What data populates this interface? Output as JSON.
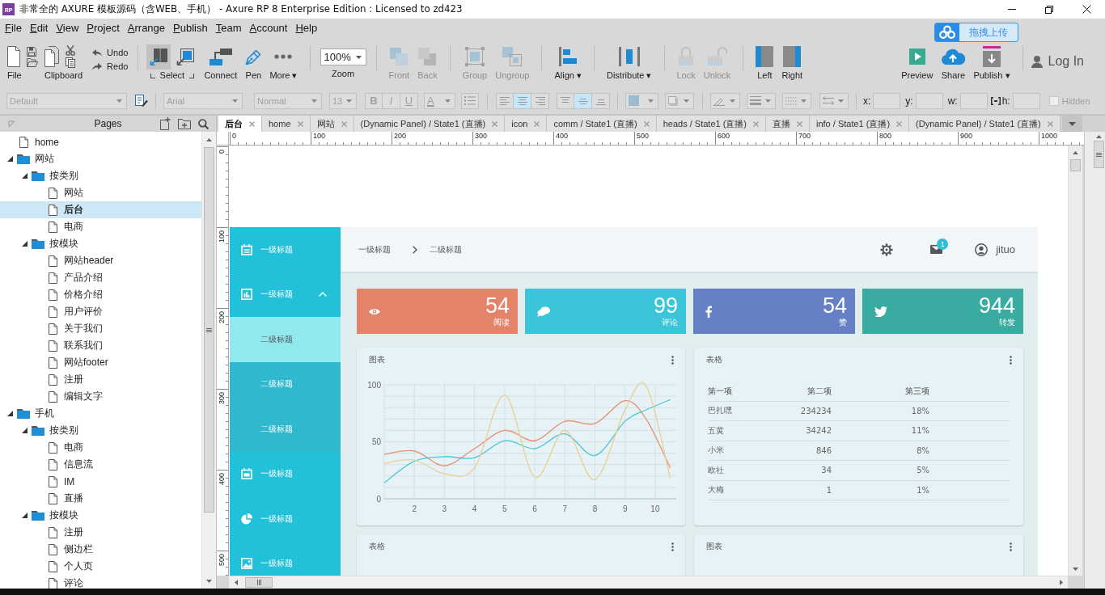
{
  "window": {
    "icon_label": "RP",
    "title": "非常全的 AXURE 模板源码（含WEB、手机） - Axure RP 8 Enterprise Edition : Licensed to zd423"
  },
  "menu": [
    {
      "label": "File"
    },
    {
      "label": "Edit"
    },
    {
      "label": "View"
    },
    {
      "label": "Project"
    },
    {
      "label": "Arrange"
    },
    {
      "label": "Publish"
    },
    {
      "label": "Team"
    },
    {
      "label": "Account"
    },
    {
      "label": "Help"
    }
  ],
  "upload_widget": {
    "label": "拖拽上传"
  },
  "toolbar": {
    "main": [
      [
        {
          "kind": "stack",
          "label": "File"
        },
        {
          "kind": "stack",
          "label": "Clipboard"
        },
        {
          "kind": "history",
          "items": [
            {
              "label": "Undo"
            },
            {
              "label": "Redo"
            }
          ]
        }
      ],
      [
        {
          "kind": "select",
          "label": "Select",
          "modes": [
            {
              "selected": true
            },
            {
              "selected": false
            }
          ]
        },
        {
          "kind": "tool",
          "label": "Connect",
          "disabled": false
        },
        {
          "kind": "tool",
          "label": "Pen",
          "disabled": false
        },
        {
          "kind": "tool",
          "label": "More ▾",
          "disabled": false
        }
      ],
      [
        {
          "kind": "zoom",
          "label": "Zoom",
          "value": "100%"
        }
      ],
      [
        {
          "kind": "tool",
          "label": "Front",
          "disabled": true
        },
        {
          "kind": "tool",
          "label": "Back",
          "disabled": true
        }
      ],
      [
        {
          "kind": "tool",
          "label": "Group",
          "disabled": true
        },
        {
          "kind": "tool",
          "label": "Ungroup",
          "disabled": true
        }
      ],
      [
        {
          "kind": "tool",
          "label": "Align ▾",
          "disabled": false
        }
      ],
      [
        {
          "kind": "tool",
          "label": "Distribute ▾",
          "disabled": false
        }
      ],
      [
        {
          "kind": "tool",
          "label": "Lock",
          "disabled": true
        },
        {
          "kind": "tool",
          "label": "Unlock",
          "disabled": true
        }
      ],
      [
        {
          "kind": "tool",
          "label": "Left",
          "disabled": false
        },
        {
          "kind": "tool",
          "label": "Right",
          "disabled": false
        }
      ]
    ],
    "end": [
      [
        {
          "kind": "tool",
          "label": "Preview",
          "disabled": false
        },
        {
          "kind": "tool",
          "label": "Share",
          "disabled": false
        },
        {
          "kind": "tool",
          "label": "Publish ▾",
          "disabled": false
        }
      ],
      [
        {
          "kind": "login",
          "label": "Log In"
        }
      ]
    ]
  },
  "format_bar": {
    "disabled": true,
    "style": "Default",
    "font": "Arial",
    "weight": "Normal",
    "size": "13",
    "text_buttons": [
      "B",
      "I",
      "U"
    ],
    "color_button": "A",
    "align": [
      {
        "selected": false
      },
      {
        "selected": true
      },
      {
        "selected": false
      }
    ],
    "valign": [
      {
        "selected": false
      },
      {
        "selected": true
      },
      {
        "selected": false
      }
    ],
    "fields": [
      {
        "label": "x:"
      },
      {
        "label": "y:"
      },
      {
        "label": "w:"
      },
      {
        "label": "h:"
      }
    ],
    "hidden": {
      "label": "Hidden",
      "checked": false
    }
  },
  "pages_panel": {
    "title": "Pages",
    "tree": [
      {
        "kind": "page",
        "label": "home",
        "selected": false
      },
      {
        "kind": "folder",
        "label": "网站",
        "expanded": true,
        "selected": false,
        "children": [
          {
            "kind": "folder",
            "label": "按类别",
            "expanded": true,
            "selected": false,
            "children": [
              {
                "kind": "page",
                "label": "网站",
                "selected": false
              },
              {
                "kind": "page",
                "label": "后台",
                "selected": true
              },
              {
                "kind": "page",
                "label": "电商",
                "selected": false
              }
            ]
          },
          {
            "kind": "folder",
            "label": "按模块",
            "expanded": true,
            "selected": false,
            "children": [
              {
                "kind": "page",
                "label": "网站header",
                "selected": false
              },
              {
                "kind": "page",
                "label": "产品介绍",
                "selected": false
              },
              {
                "kind": "page",
                "label": "价格介绍",
                "selected": false
              },
              {
                "kind": "page",
                "label": "用户评价",
                "selected": false
              },
              {
                "kind": "page",
                "label": "关于我们",
                "selected": false
              },
              {
                "kind": "page",
                "label": "联系我们",
                "selected": false
              },
              {
                "kind": "page",
                "label": "网站footer",
                "selected": false
              },
              {
                "kind": "page",
                "label": "注册",
                "selected": false
              },
              {
                "kind": "page",
                "label": "编辑文字",
                "selected": false
              }
            ]
          }
        ]
      },
      {
        "kind": "folder",
        "label": "手机",
        "expanded": true,
        "selected": false,
        "children": [
          {
            "kind": "folder",
            "label": "按类别",
            "expanded": true,
            "selected": false,
            "children": [
              {
                "kind": "page",
                "label": "电商",
                "selected": false
              },
              {
                "kind": "page",
                "label": "信息流",
                "selected": false
              },
              {
                "kind": "page",
                "label": "IM",
                "selected": false
              },
              {
                "kind": "page",
                "label": "直播",
                "selected": false
              }
            ]
          },
          {
            "kind": "folder",
            "label": "按模块",
            "expanded": true,
            "selected": false,
            "children": [
              {
                "kind": "page",
                "label": "注册",
                "selected": false
              },
              {
                "kind": "page",
                "label": "侧边栏",
                "selected": false
              },
              {
                "kind": "page",
                "label": "个人页",
                "selected": false
              },
              {
                "kind": "page",
                "label": "评论",
                "selected": false
              }
            ]
          }
        ]
      }
    ]
  },
  "tabs": [
    {
      "label": "后台",
      "selected": true
    },
    {
      "label": "home",
      "selected": false
    },
    {
      "label": "网站",
      "selected": false
    },
    {
      "label": "(Dynamic Panel) / State1 (直播)",
      "selected": false
    },
    {
      "label": "icon",
      "selected": false
    },
    {
      "label": "comm / State1 (直播)",
      "selected": false
    },
    {
      "label": "heads / State1 (直播)",
      "selected": false
    },
    {
      "label": "直播",
      "selected": false
    },
    {
      "label": "info / State1 (直播)",
      "selected": false
    },
    {
      "label": "(Dynamic Panel) / State1 (直播)",
      "selected": false
    }
  ],
  "rulers": {
    "horizontal": [
      "0",
      "100",
      "200",
      "300",
      "400",
      "500",
      "600",
      "700",
      "800",
      "900",
      "1000"
    ],
    "vertical": [
      "0",
      "100",
      "200",
      "300",
      "400",
      "500"
    ]
  },
  "dashboard": {
    "sidebar": [
      {
        "label": "一级标题",
        "selected": false
      },
      {
        "label": "一级标题",
        "selected": false,
        "expanded": true,
        "children": [
          {
            "label": "二级标题",
            "selected": true
          },
          {
            "label": "二级标题",
            "selected": false
          },
          {
            "label": "二级标题",
            "selected": false
          }
        ]
      },
      {
        "label": "一级标题",
        "selected": false
      },
      {
        "label": "一级标题",
        "selected": false
      },
      {
        "label": "一级标题",
        "selected": false
      }
    ],
    "header": {
      "breadcrumb": [
        "一级标题",
        "二级标题"
      ],
      "notification_count": "1",
      "username": "jituo"
    },
    "stats": [
      {
        "value": "54",
        "label": "阅读",
        "color": "#e2836a"
      },
      {
        "value": "99",
        "label": "评论",
        "color": "#3bc5d8"
      },
      {
        "value": "54",
        "label": "赞",
        "color": "#6680c6"
      },
      {
        "value": "944",
        "label": "转发",
        "color": "#3aaba1"
      }
    ],
    "panels": [
      {
        "kind": "chart",
        "title": "图表",
        "chart_data": {
          "type": "line",
          "grid": true,
          "x": [
            1,
            2,
            3,
            4,
            5,
            6,
            7,
            8,
            9,
            9.7,
            10.5
          ],
          "xlim": [
            1,
            10.7
          ],
          "ylim": [
            0,
            100
          ],
          "xticks": [
            2,
            3,
            4,
            5,
            6,
            7,
            8,
            9,
            10
          ],
          "yticks": [
            0,
            50,
            100
          ],
          "series": [
            {
              "color": "#e8906f",
              "values": [
                39,
                42,
                29,
                44,
                60,
                51,
                68,
                66,
                86,
                70,
                27
              ]
            },
            {
              "color": "#4dc6d6",
              "values": [
                14,
                33,
                37,
                36,
                51,
                44,
                57,
                38,
                68,
                78,
                87
              ]
            },
            {
              "color": "#e9d08e",
              "values": [
                31,
                34,
                22,
                27,
                91,
                19,
                60,
                17,
                78,
                99,
                18
              ]
            }
          ]
        }
      },
      {
        "kind": "table",
        "title": "表格",
        "table": {
          "columns": [
            "第一项",
            "第二项",
            "第三项"
          ],
          "rows": [
            [
              "巴扎嘿",
              "234234",
              "18%"
            ],
            [
              "五黄",
              "34242",
              "11%"
            ],
            [
              "小米",
              "846",
              "8%"
            ],
            [
              "欧社",
              "34",
              "5%"
            ],
            [
              "大梅",
              "1",
              "1%"
            ]
          ]
        }
      },
      {
        "kind": "table",
        "title": "表格"
      },
      {
        "kind": "chart",
        "title": "图表"
      }
    ]
  }
}
